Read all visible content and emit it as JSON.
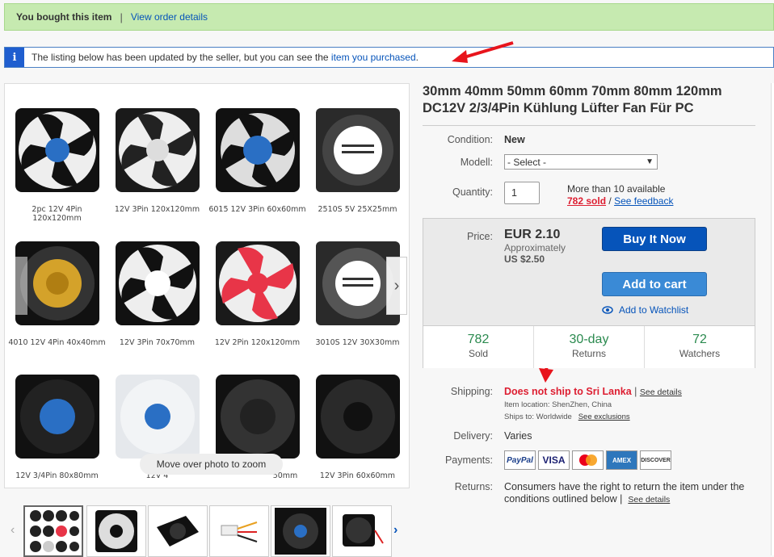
{
  "banner": {
    "bought": "You bought this item",
    "sep": "|",
    "link": "View order details"
  },
  "notice": {
    "icon": "info-icon",
    "text": "The listing below has been updated by the seller, but you can see the ",
    "link": "item you purchased",
    "end": "."
  },
  "gallery": {
    "captions": [
      "2pc 12V 4Pin 120x120mm",
      "12V 3Pin 120x120mm",
      "6015 12V 3Pin 60x60mm",
      "2510S 5V 25X25mm",
      "4010 12V 4Pin 40x40mm",
      "12V 3Pin 70x70mm",
      "12V 2Pin 120x120mm",
      "3010S 12V 30X30mm",
      "12V 3/4Pin 80x80mm",
      "12V 4",
      "50mm",
      "12V 3Pin 60x60mm"
    ],
    "zoom_hint": "Move over photo to zoom",
    "next_icon": "chevron-right-icon"
  },
  "product": {
    "title": "30mm 40mm 50mm 60mm 70mm 80mm 120mm DC12V 2/3/4Pin Kühlung Lüfter Fan Für PC",
    "condition_label": "Condition:",
    "condition": "New",
    "model_label": "Modell:",
    "model_value": "- Select -",
    "quantity_label": "Quantity:",
    "quantity": "1",
    "available": "More than 10 available",
    "sold_link": "782 sold",
    "slash": "/",
    "feedback_link": "See feedback"
  },
  "price": {
    "label": "Price:",
    "value": "EUR 2.10",
    "approx": "Approximately",
    "usd": "US $2.50",
    "buy": "Buy It Now",
    "cart": "Add to cart",
    "watch": "Add to Watchlist"
  },
  "stats": [
    {
      "num": "782",
      "label": "Sold"
    },
    {
      "num": "30-day",
      "label": "Returns"
    },
    {
      "num": "72",
      "label": "Watchers"
    }
  ],
  "shipping": {
    "label": "Shipping:",
    "status": "Does not ship to Sri Lanka",
    "sep": "|",
    "details": "See details",
    "location": "Item location: ShenZhen, China",
    "ships_to": "Ships to:",
    "worldwide": "Worldwide",
    "exclusions": "See exclusions"
  },
  "delivery": {
    "label": "Delivery:",
    "value": "Varies"
  },
  "payments": {
    "label": "Payments:",
    "methods": [
      "PayPal",
      "VISA",
      "",
      "AMEX",
      "DISCOVER"
    ]
  },
  "returns": {
    "label": "Returns:",
    "text": "Consumers have the right to return the item under the conditions outlined below |",
    "details": "See details"
  },
  "colors": {
    "accent_blue": "#0654ba",
    "alert_red": "#dd1e31",
    "banner_green": "#c6eab0"
  }
}
